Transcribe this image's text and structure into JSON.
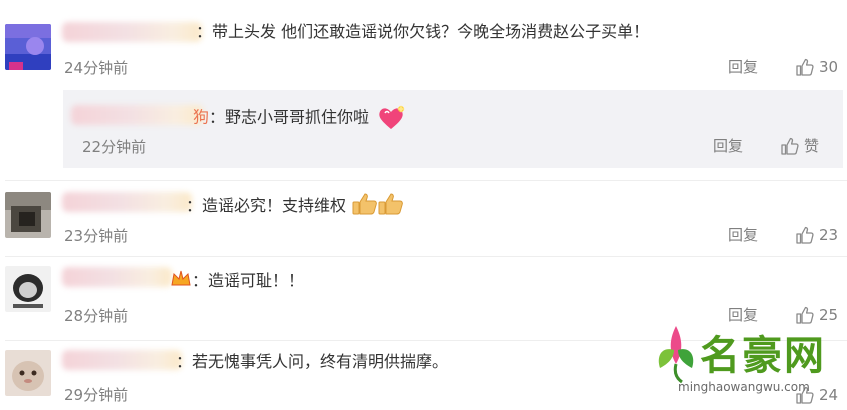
{
  "comments": [
    {
      "text": "：带上头发 他们还敢造谣说你欠钱？今晚全场消费赵公子买单！",
      "time": "24分钟前",
      "reply_label": "回复",
      "likes": "30"
    },
    {
      "name_tail": "狗",
      "text": "：野志小哥哥抓住你啦",
      "time": "22分钟前",
      "reply_label": "回复",
      "likes": "赞"
    },
    {
      "text": "：造谣必究！支持维权",
      "time": "23分钟前",
      "reply_label": "回复",
      "likes": "23"
    },
    {
      "text": "：造谣可耻！！",
      "time": "28分钟前",
      "reply_label": "回复",
      "likes": "25"
    },
    {
      "text": "：若无愧事凭人问，终有清明供揣摩。",
      "time": "29分钟前",
      "reply_label": "",
      "likes": "24"
    }
  ],
  "watermark": {
    "title": "名豪网",
    "url": "minghaowangwu.com"
  }
}
